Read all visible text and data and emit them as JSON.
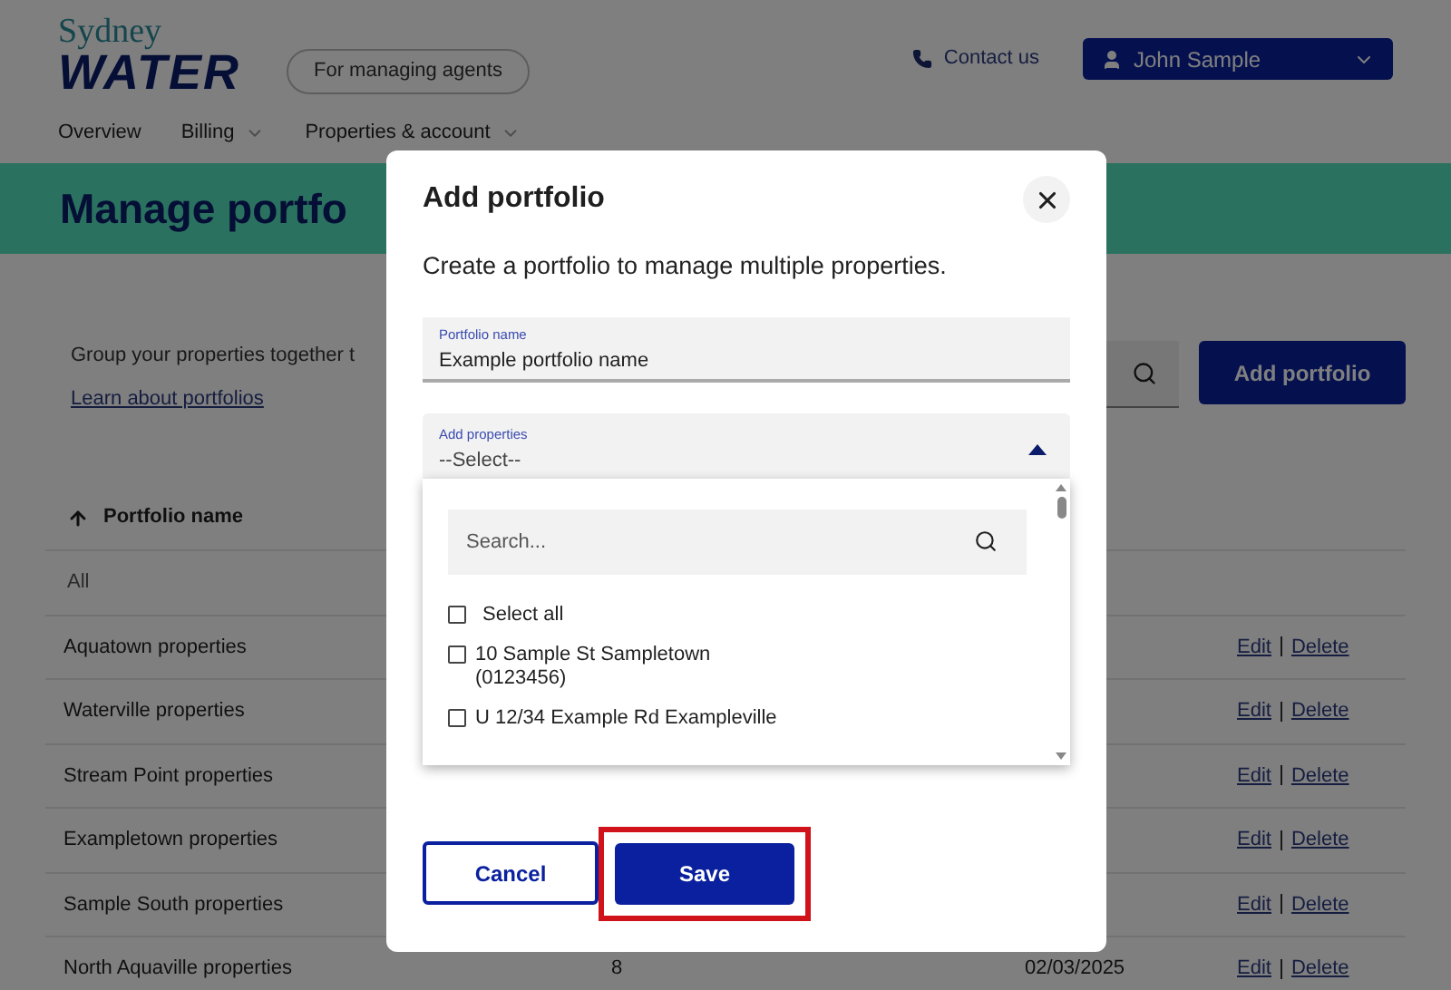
{
  "header": {
    "logo_top": "Sydney",
    "logo_bottom": "WATER",
    "audience": "For managing agents",
    "contact": "Contact us",
    "user": "John Sample"
  },
  "nav": [
    {
      "label": "Overview",
      "has_menu": false
    },
    {
      "label": "Billing",
      "has_menu": true
    },
    {
      "label": "Properties & account",
      "has_menu": true
    }
  ],
  "page": {
    "title": "Manage portfo",
    "intro": "Group your properties together t",
    "learn_link": "Learn about portfolios",
    "add_button": "Add portfolio"
  },
  "table": {
    "sort_column": "Portfolio name",
    "rows": [
      {
        "name": "All"
      },
      {
        "name": "Aquatown properties",
        "edit": "Edit",
        "delete": "Delete"
      },
      {
        "name": "Waterville properties",
        "edit": "Edit",
        "delete": "Delete"
      },
      {
        "name": "Stream Point properties",
        "edit": "Edit",
        "delete": "Delete"
      },
      {
        "name": "Exampletown properties",
        "edit": "Edit",
        "delete": "Delete"
      },
      {
        "name": "Sample South properties",
        "edit": "Edit",
        "delete": "Delete"
      },
      {
        "name": "North Aquaville properties",
        "count": "8",
        "date": "02/03/2025",
        "edit": "Edit",
        "delete": "Delete"
      }
    ]
  },
  "dialog": {
    "title": "Add portfolio",
    "description": "Create a portfolio to manage multiple properties.",
    "name_field": {
      "label": "Portfolio name",
      "value": "Example portfolio name"
    },
    "properties_field": {
      "label": "Add properties",
      "value": "--Select--",
      "expanded": true
    },
    "search": {
      "placeholder": "Search..."
    },
    "options": [
      {
        "label": "Select all",
        "checked": false
      },
      {
        "label": "10 Sample St Sampletown",
        "account": "(0123456)",
        "checked": false
      },
      {
        "label": "U 12/34 Example Rd Exampleville",
        "checked": false
      }
    ],
    "cancel": "Cancel",
    "save": {
      "label": "Save",
      "highlighted": true
    }
  }
}
